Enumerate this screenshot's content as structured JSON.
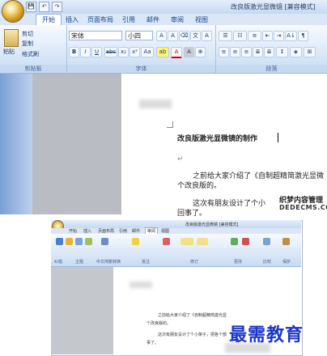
{
  "top_window": {
    "title": "改良版激光显微镜 [兼容模式]",
    "qat": [
      "💾",
      "↶",
      "↷"
    ],
    "tabs": [
      "开始",
      "插入",
      "页面布局",
      "引用",
      "邮件",
      "审阅",
      "视图"
    ],
    "clipboard": {
      "cut": "剪切",
      "copy": "复制",
      "paste": "粘贴",
      "format_painter": "格式刷",
      "group_label": "剪贴板"
    },
    "font": {
      "name": "宋体",
      "size": "小四",
      "group_label": "字体"
    },
    "paragraph": {
      "group_label": "段落"
    },
    "doc": {
      "heading": "改良版激光显微镜的制作",
      "para1_a": "之前给大家介绍了《自制超精简激光显微",
      "para1_b": "个改良版的。",
      "para2_a": "这次有朋友设计了个小",
      "para2_b": "回事了。",
      "return_mark": "↵",
      "watermark_top": "织梦内容管理",
      "watermark_bottom": "DEDECMS.COM"
    }
  },
  "bottom_window": {
    "title": "改良版激光显微镜 [兼容模式]",
    "tabs": [
      "开始",
      "插入",
      "页面布局",
      "引用",
      "邮件",
      "审阅",
      "视图"
    ],
    "groups": [
      "纠错",
      "主题",
      "中文简繁转换",
      "批注",
      "修订",
      "更改",
      "比较",
      "保护"
    ],
    "doc": {
      "para1_a": "之前给大家介绍了《自制超精简激光显",
      "para1_b": "个改良版的。",
      "para2_a": "这次有朋友设计了个小架子，把各个部",
      "para2_b": "事了。"
    },
    "watermark": "最需教育"
  }
}
